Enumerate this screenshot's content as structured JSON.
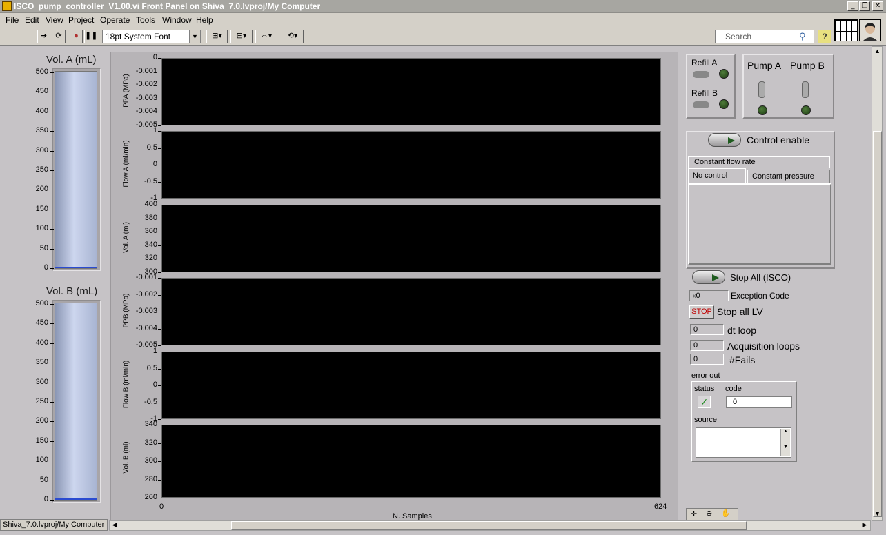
{
  "window": {
    "title": "ISCO_pump_controller_V1.00.vi Front Panel on Shiva_7.0.lvproj/My Computer",
    "controls": [
      "_",
      "❐",
      "✕"
    ]
  },
  "menubar": [
    "File",
    "Edit",
    "View",
    "Project",
    "Operate",
    "Tools",
    "Window",
    "Help"
  ],
  "toolbar": {
    "font_select": "18pt System Font",
    "search_placeholder": "Search",
    "help_label": "?"
  },
  "tanks": [
    {
      "label": "Vol. A (mL)",
      "ticks": [
        "500",
        "450",
        "400",
        "350",
        "300",
        "250",
        "200",
        "150",
        "100",
        "50",
        "0"
      ],
      "fill_fraction": 0.0
    },
    {
      "label": "Vol. B (mL)",
      "ticks": [
        "500",
        "450",
        "400",
        "350",
        "300",
        "250",
        "200",
        "150",
        "100",
        "50",
        "0"
      ],
      "fill_fraction": 0.0
    }
  ],
  "graphs": [
    {
      "ylabel": "PPA (MPa)",
      "ticks": [
        "0",
        "-0.001",
        "-0.002",
        "-0.003",
        "-0.004",
        "-0.005"
      ]
    },
    {
      "ylabel": "Flow A (ml/min)",
      "ticks": [
        "1",
        "0.5",
        "0",
        "-0.5",
        "-1"
      ]
    },
    {
      "ylabel": "Vol. A (ml)",
      "ticks": [
        "400",
        "380",
        "360",
        "340",
        "320",
        "300"
      ]
    },
    {
      "ylabel": "PPB (MPa)",
      "ticks": [
        "-0.001",
        "-0.002",
        "-0.003",
        "-0.004",
        "-0.005"
      ]
    },
    {
      "ylabel": "Flow B (ml/min)",
      "ticks": [
        "1",
        "0.5",
        "0",
        "-0.5",
        "-1"
      ]
    },
    {
      "ylabel": "Vol. B (ml)",
      "ticks": [
        "340",
        "320",
        "300",
        "280",
        "260"
      ]
    }
  ],
  "xaxis": {
    "label": "N. Samples",
    "min": "0",
    "max": "624"
  },
  "right": {
    "refill_a": "Refill A",
    "refill_b": "Refill B",
    "pump_a": "Pump A",
    "pump_b": "Pump B",
    "control_enable": "Control enable",
    "tabs": {
      "top": "Constant flow rate",
      "left": "No control",
      "right": "Constant pressure"
    },
    "stop_all_isco": "Stop All (ISCO)",
    "exception_code_value": "0",
    "exception_code_label": "Exception Code",
    "stop_button": "STOP",
    "stop_all_lv": "Stop all LV",
    "dt_loop_value": "0",
    "dt_loop_label": "dt loop",
    "acq_loops_value": "0",
    "acq_loops_label": "Acquisition loops",
    "fails_value": "0",
    "fails_label": "#Fails",
    "error_out": {
      "title": "error out",
      "status_label": "status",
      "code_label": "code",
      "code_value": "0",
      "source_label": "source",
      "status_ok": true
    }
  },
  "statusbar": {
    "path": "Shiva_7.0.lvproj/My Computer"
  }
}
